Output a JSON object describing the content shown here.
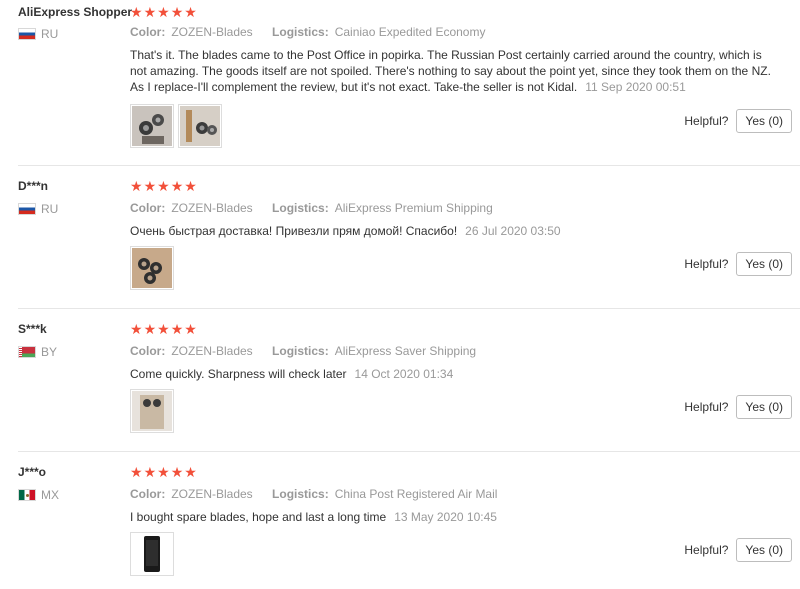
{
  "labels": {
    "color_key": "Color:",
    "logistics_key": "Logistics:",
    "helpful": "Helpful?",
    "star": "★"
  },
  "reviews": [
    {
      "user": "AliExpress Shopper",
      "country_code": "RU",
      "rating": 5,
      "color": "ZOZEN-Blades",
      "logistics": "Cainiao Expedited Economy",
      "text": "That's it. The blades came to the Post Office in popirka. The Russian Post certainly carried around the country, which is not amazing. The goods itself are not spoiled. There's nothing to say about the point yet, since they took them on the NZ. As I replace-I'll complement the review, but it's not exact. Take-the seller is not Kidal.",
      "time": "11 Sep 2020 00:51",
      "yes_label": "Yes (0)",
      "thumbnails": [
        "blades-photo",
        "blades-photo"
      ]
    },
    {
      "user": "D***n",
      "country_code": "RU",
      "rating": 5,
      "color": "ZOZEN-Blades",
      "logistics": "AliExpress Premium Shipping",
      "text": "Очень быстрая доставка! Привезли прям домой! Спасибо!",
      "time": "26 Jul 2020 03:50",
      "yes_label": "Yes (0)",
      "thumbnails": [
        "blades-photo"
      ]
    },
    {
      "user": "S***k",
      "country_code": "BY",
      "rating": 5,
      "color": "ZOZEN-Blades",
      "logistics": "AliExpress Saver Shipping",
      "text": "Come quickly. Sharpness will check later",
      "time": "14 Oct 2020 01:34",
      "yes_label": "Yes (0)",
      "thumbnails": [
        "blades-photo"
      ]
    },
    {
      "user": "J***o",
      "country_code": "MX",
      "rating": 5,
      "color": "ZOZEN-Blades",
      "logistics": "China Post Registered Air Mail",
      "text": "I bought spare blades, hope and last a long time",
      "time": "13 May 2020 10:45",
      "yes_label": "Yes (0)",
      "thumbnails": [
        "phone-photo"
      ]
    }
  ]
}
